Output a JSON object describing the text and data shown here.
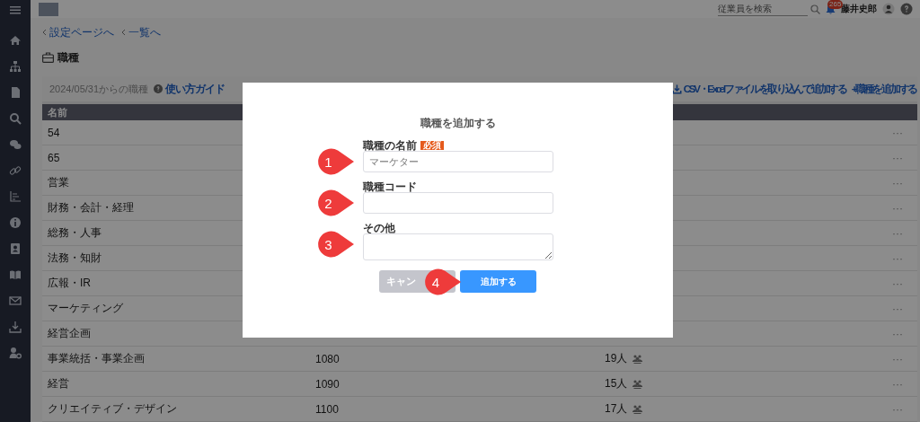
{
  "topbar": {
    "search": {
      "placeholder": "従業員を検索"
    },
    "notification_count": "265",
    "user_name": "藤井史郎"
  },
  "breadcrumbs": [
    "設定ページへ",
    "一覧へ"
  ],
  "page_title": "職種",
  "toolbar": {
    "period": "2024/05/31からの職種",
    "guide_link": "使い方ガイド",
    "import_link": "CSV・Excelファイルを取り込んで追加する",
    "add_link": "+職種を追加する"
  },
  "table": {
    "columns": [
      "名前"
    ],
    "rows": [
      {
        "name": "54",
        "more": "···"
      },
      {
        "name": "65",
        "more": "···"
      },
      {
        "name": "営業",
        "more": "···"
      },
      {
        "name": "財務・会計・経理",
        "more": "···"
      },
      {
        "name": "総務・人事",
        "more": "···"
      },
      {
        "name": "法務・知財",
        "more": "···"
      },
      {
        "name": "広報・IR",
        "more": "···"
      },
      {
        "name": "マーケティング",
        "more": "···"
      },
      {
        "name": "経営企画",
        "more": "···"
      },
      {
        "name": "事業統括・事業企画",
        "code": "1080",
        "count": "19人",
        "more": "···"
      },
      {
        "name": "経営",
        "code": "1090",
        "count": "15人",
        "more": "···"
      },
      {
        "name": "クリエイティブ・デザイン",
        "code": "1100",
        "count": "17人",
        "more": "···"
      }
    ]
  },
  "dialog": {
    "title": "職種を追加する",
    "fields": [
      {
        "kind": "input",
        "label": "職種の名前",
        "required_badge": "必須",
        "placeholder": "マーケター"
      },
      {
        "kind": "input",
        "label": "職種コード"
      },
      {
        "kind": "textarea",
        "label": "その他"
      }
    ],
    "buttons": [
      {
        "kind": "cancel",
        "label": "キャン"
      },
      {
        "kind": "primary",
        "label": "追加する"
      }
    ]
  },
  "callouts": [
    "1",
    "2",
    "3",
    "4"
  ]
}
